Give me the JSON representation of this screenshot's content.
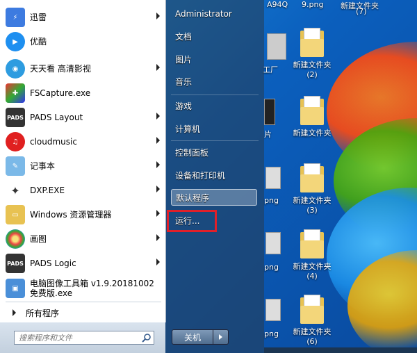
{
  "start_menu": {
    "programs": [
      {
        "label": "迅雷",
        "icon": "thunder-icon",
        "arrow": true
      },
      {
        "label": "优酷",
        "icon": "youku-icon",
        "arrow": false
      },
      {
        "label": "天天看 高清影视",
        "icon": "tiantiankan-icon",
        "arrow": true
      },
      {
        "label": "FSCapture.exe",
        "icon": "fscapture-icon",
        "arrow": false
      },
      {
        "label": "PADS Layout",
        "icon": "pads-layout-icon",
        "arrow": true
      },
      {
        "label": "cloudmusic",
        "icon": "cloudmusic-icon",
        "arrow": true
      },
      {
        "label": "记事本",
        "icon": "notepad-icon",
        "arrow": true
      },
      {
        "label": "DXP.EXE",
        "icon": "dxp-icon",
        "arrow": true
      },
      {
        "label": "Windows 资源管理器",
        "icon": "explorer-icon",
        "arrow": true
      },
      {
        "label": "画图",
        "icon": "paint-icon",
        "arrow": true
      },
      {
        "label": "PADS Logic",
        "icon": "pads-logic-icon",
        "arrow": true
      },
      {
        "label": "电脑图像工具箱 v1.9.20181002\n免费版.exe",
        "icon": "image-toolbox-icon",
        "arrow": false
      }
    ],
    "all_programs": "所有程序",
    "search_placeholder": "搜索程序和文件",
    "right_items": {
      "user": "Administrator",
      "documents": "文档",
      "pictures": "图片",
      "music": "音乐",
      "games": "游戏",
      "computer": "计算机",
      "control_panel": "控制面板",
      "devices": "设备和打印机",
      "default_programs": "默认程序",
      "run": "运行..."
    },
    "shutdown_label": "关机"
  },
  "desktop": {
    "top_labels": [
      "A94Q",
      "9.png",
      "新建文件夹",
      "(7)"
    ],
    "folders": [
      {
        "label": "新建文件夹",
        "num": "(2)"
      },
      {
        "label": "新建文件夹",
        "num": ""
      },
      {
        "label": "新建文件夹",
        "num": "(3)"
      },
      {
        "label": "新建文件夹",
        "num": "(4)"
      },
      {
        "label": "新建文件夹",
        "num": "(6)"
      }
    ],
    "partial_labels": [
      "工厂",
      "片",
      "png",
      "png",
      "png"
    ]
  },
  "colors": {
    "highlight_box": "#e0202a",
    "desktop_blue": "#1a8fe2"
  }
}
